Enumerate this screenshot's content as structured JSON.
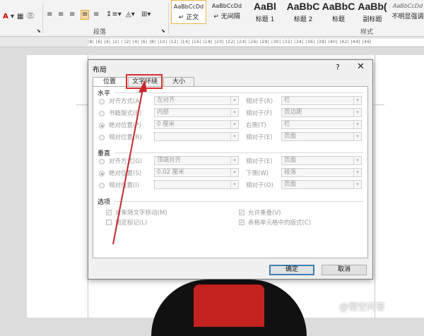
{
  "ribbon": {
    "font_color_glyph": "A",
    "paragraph_group": "段落",
    "styles_group": "样式",
    "styles": [
      {
        "preview": "AaBbCcDd",
        "name": "↵ 正文",
        "big": false,
        "active": true
      },
      {
        "preview": "AaBbCcDd",
        "name": "↵ 无间隔",
        "big": false,
        "active": false
      },
      {
        "preview": "AaBl",
        "name": "标题 1",
        "big": true,
        "active": false
      },
      {
        "preview": "AaBbC",
        "name": "标题 2",
        "big": true,
        "active": false
      },
      {
        "preview": "AaBbC",
        "name": "标题",
        "big": true,
        "active": false
      },
      {
        "preview": "AaBb(",
        "name": "副标题",
        "big": true,
        "active": false
      },
      {
        "preview": "AaBbCcDd",
        "name": "不明显强调",
        "big": false,
        "active": false
      }
    ]
  },
  "ruler": {
    "text": "|8| |6| |4| |2| | |2| |4| |6| |8| |10| |12| |14| |16| |18| |20| |22| |24| |26| |28| |30| |32| |34| |36| |38| |40| |42| |44| |46|"
  },
  "dialog": {
    "title": "布局",
    "help": "?",
    "close": "✕",
    "tabs": [
      "位置",
      "文字环绕",
      "大小"
    ],
    "horizontal": {
      "label": "水平",
      "rows": [
        {
          "option": "对齐方式(A)",
          "value": "左对齐",
          "relative_label": "相对于(R)",
          "relative_value": "栏"
        },
        {
          "option": "书籍版式(B)",
          "value": "内部",
          "relative_label": "相对于(F)",
          "relative_value": "页边距"
        },
        {
          "option": "绝对位置(P)",
          "value": "0 厘米",
          "relative_label": "右侧(T)",
          "relative_value": "栏"
        },
        {
          "option": "相对位置(R)",
          "value": "",
          "relative_label": "相对于(E)",
          "relative_value": "页面"
        }
      ]
    },
    "vertical": {
      "label": "垂直",
      "rows": [
        {
          "option": "对齐方式(G)",
          "value": "顶端对齐",
          "relative_label": "相对于(E)",
          "relative_value": "页面"
        },
        {
          "option": "绝对位置(S)",
          "value": "0.02 厘米",
          "relative_label": "下侧(W)",
          "relative_value": "段落"
        },
        {
          "option": "相对位置(I)",
          "value": "",
          "relative_label": "相对于(O)",
          "relative_value": "页面"
        }
      ]
    },
    "options": {
      "label": "选项",
      "move_with_text": "对象随文字移动(M)",
      "lock_anchor": "锁定标记(L)",
      "allow_overlap": "允许重叠(V)",
      "layout_in_cell": "表格单元格中的版式(C)"
    },
    "ok": "确定",
    "cancel": "取消"
  },
  "watermark": "@悟空问答",
  "colors": {
    "highlight": "#d9302c",
    "arrow": "#c8262a",
    "active_style_border": "#f0b34a"
  }
}
